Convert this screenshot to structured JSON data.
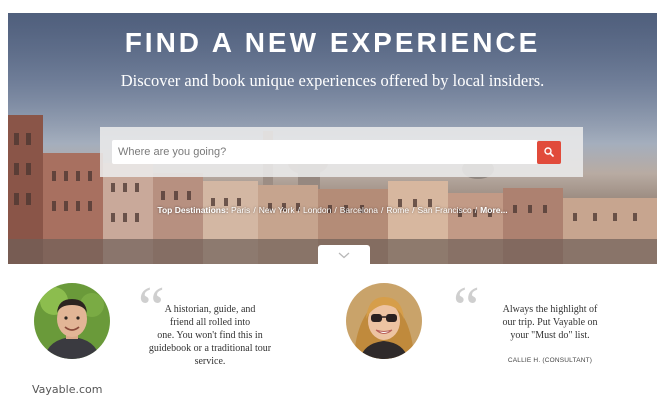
{
  "hero": {
    "title": "FIND A NEW EXPERIENCE",
    "subtitle": "Discover and book unique experiences offered by local insiders."
  },
  "search": {
    "placeholder": "Where are you going?",
    "button_icon": "search-icon",
    "button_color": "#e14b3b"
  },
  "destinations": {
    "label": "Top Destinations:",
    "items": [
      "Paris",
      "New York",
      "London",
      "Barcelona",
      "Rome",
      "San Francisco"
    ],
    "more": "More..."
  },
  "scroll_icon": "chevron-down-icon",
  "testimonials": [
    {
      "avatar_icon": "avatar-man",
      "quote_mark": "“",
      "lines": [
        "A historian, guide, and",
        "friend all rolled into",
        "one. You won't find this in",
        "guidebook or a traditional tour",
        "service."
      ]
    },
    {
      "avatar_icon": "avatar-woman",
      "quote_mark": "“",
      "lines": [
        "Always the highlight of",
        "our trip. Put Vayable on",
        "your \"Must do\" list."
      ],
      "author": "CALLIE H. (CONSULTANT)"
    }
  ],
  "caption": "Vayable.com"
}
